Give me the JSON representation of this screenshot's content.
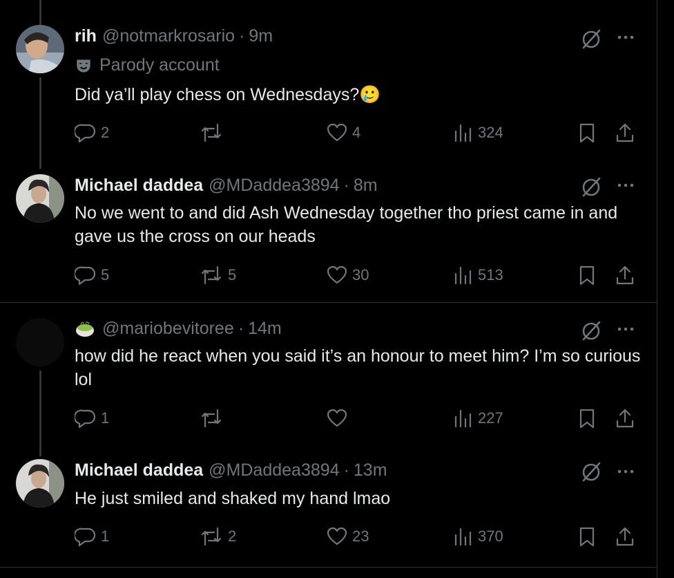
{
  "tweets": [
    {
      "name": "rih",
      "handle": "@notmarkrosario",
      "time": "9m",
      "badge": "Parody account",
      "text": "Did ya’ll play chess on Wednesdays?",
      "text_emoji": "🥲",
      "replies": "2",
      "reposts": "",
      "likes": "4",
      "views": "324"
    },
    {
      "name": "Michael daddea",
      "handle": "@MDaddea3894",
      "time": "8m",
      "text": "No we went to and did Ash Wednesday together tho priest came in and gave us the cross on our heads",
      "replies": "5",
      "reposts": "5",
      "likes": "30",
      "views": "513"
    },
    {
      "name": "",
      "handle": "@mariobevitoree",
      "time": "14m",
      "text": "how did he react when you said it’s an honour to meet him? I’m so curious lol",
      "replies": "1",
      "reposts": "",
      "likes": "",
      "views": "227"
    },
    {
      "name": "Michael daddea",
      "handle": "@MDaddea3894",
      "time": "13m",
      "text": "He just smiled and shaked my hand lmao",
      "replies": "1",
      "reposts": "2",
      "likes": "23",
      "views": "370"
    }
  ],
  "icons": [
    "parody-mask-icon",
    "grok-icon",
    "more-icon",
    "reply-icon",
    "repost-icon",
    "like-icon",
    "views-icon",
    "bookmark-icon",
    "share-icon",
    "matcha-emoji-icon"
  ],
  "colors": {
    "background": "#000000",
    "text": "#e7e9ea",
    "secondary": "#71767b",
    "border": "#2f3336"
  }
}
